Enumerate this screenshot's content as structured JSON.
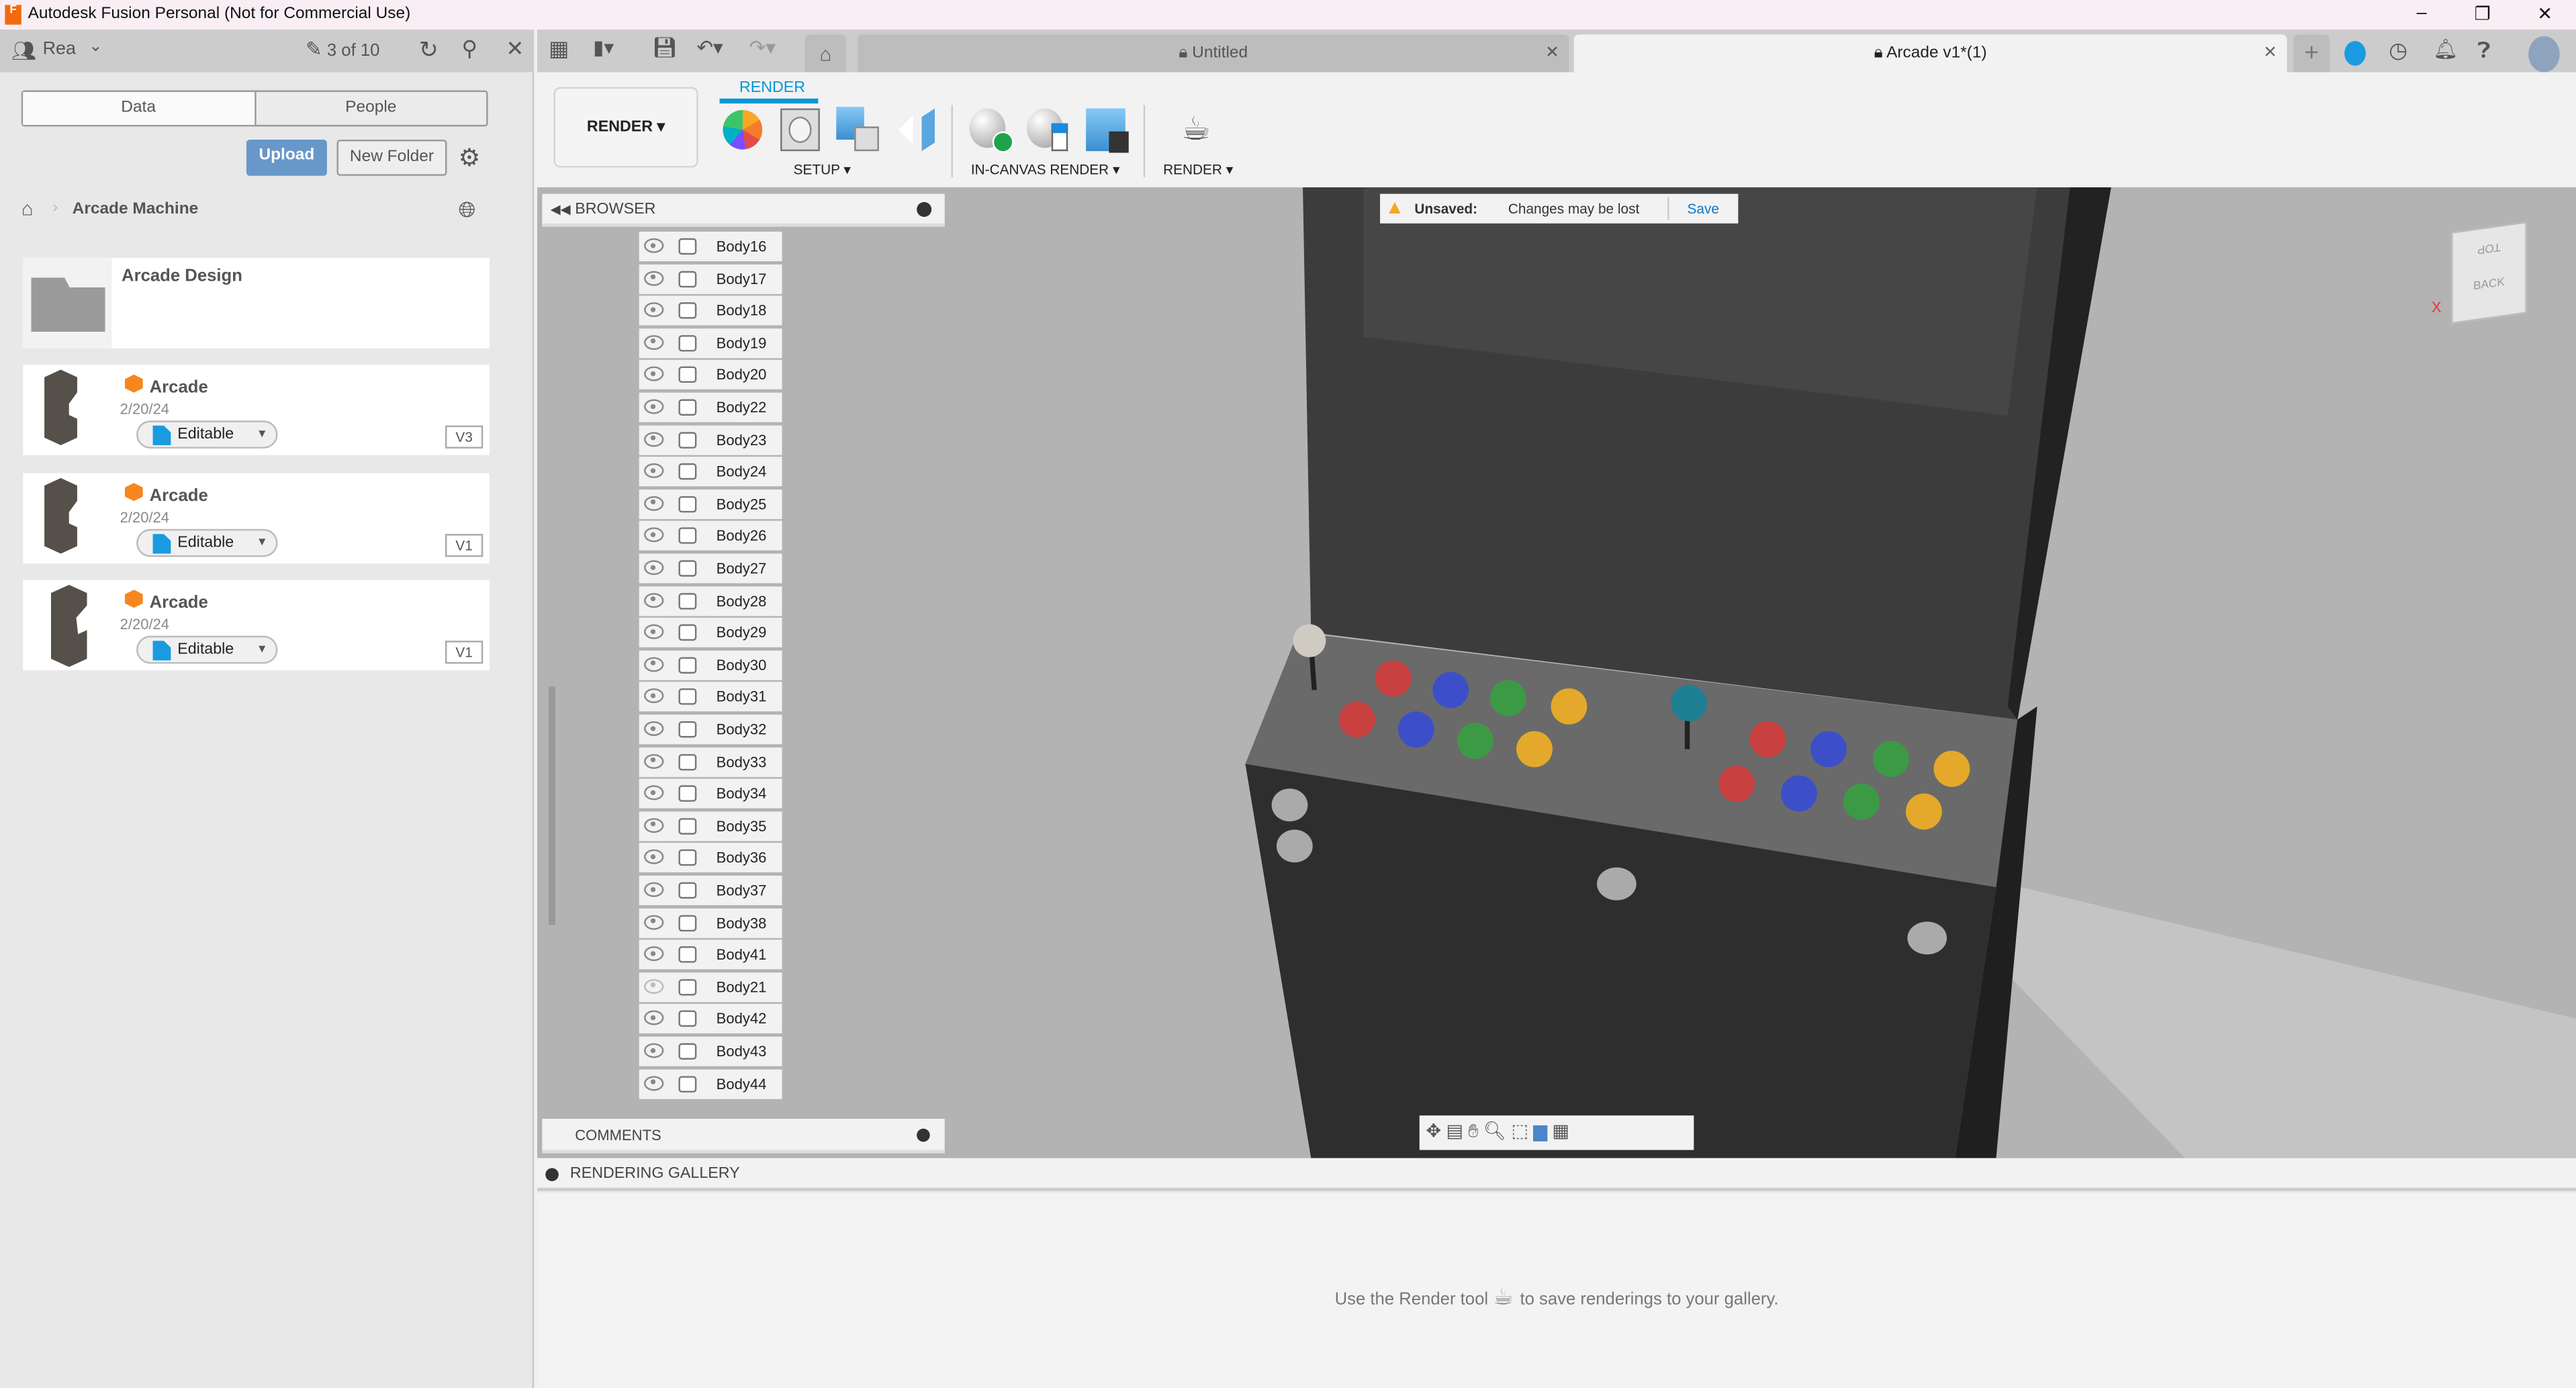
{
  "window": {
    "title": "Autodesk Fusion Personal (Not for Commercial Use)",
    "app_icon": "F"
  },
  "data_panel": {
    "team": "Rea",
    "job_count": "3 of 10",
    "tabs": [
      "Data",
      "People"
    ],
    "upload_label": "Upload",
    "new_folder_label": "New Folder",
    "breadcrumb": "Arcade Machine",
    "folder": {
      "name": "Arcade Design"
    },
    "files": [
      {
        "name": "Arcade",
        "date": "2/20/24",
        "status": "Editable",
        "version": "V3"
      },
      {
        "name": "Arcade",
        "date": "2/20/24",
        "status": "Editable",
        "version": "V1"
      },
      {
        "name": "Arcade",
        "date": "2/20/24",
        "status": "Editable",
        "version": "V1"
      }
    ]
  },
  "doc_tabs": [
    {
      "label": "Untitled",
      "active": false
    },
    {
      "label": "Arcade v1*(1)",
      "active": true
    }
  ],
  "toolbar": {
    "workspace": "RENDER",
    "active_tab": "RENDER",
    "groups": [
      "SETUP",
      "IN-CANVAS RENDER",
      "RENDER"
    ],
    "accent": "#0696d7"
  },
  "browser": {
    "title": "BROWSER",
    "items": [
      {
        "label": "Body16",
        "visible": true
      },
      {
        "label": "Body17",
        "visible": true
      },
      {
        "label": "Body18",
        "visible": true
      },
      {
        "label": "Body19",
        "visible": true
      },
      {
        "label": "Body20",
        "visible": true
      },
      {
        "label": "Body22",
        "visible": true
      },
      {
        "label": "Body23",
        "visible": true
      },
      {
        "label": "Body24",
        "visible": true
      },
      {
        "label": "Body25",
        "visible": true
      },
      {
        "label": "Body26",
        "visible": true
      },
      {
        "label": "Body27",
        "visible": true
      },
      {
        "label": "Body28",
        "visible": true
      },
      {
        "label": "Body29",
        "visible": true
      },
      {
        "label": "Body30",
        "visible": true
      },
      {
        "label": "Body31",
        "visible": true
      },
      {
        "label": "Body32",
        "visible": true
      },
      {
        "label": "Body33",
        "visible": true
      },
      {
        "label": "Body34",
        "visible": true
      },
      {
        "label": "Body35",
        "visible": true
      },
      {
        "label": "Body36",
        "visible": true
      },
      {
        "label": "Body37",
        "visible": true
      },
      {
        "label": "Body38",
        "visible": true
      },
      {
        "label": "Body41",
        "visible": true
      },
      {
        "label": "Body21",
        "visible": false
      },
      {
        "label": "Body42",
        "visible": true
      },
      {
        "label": "Body43",
        "visible": true
      },
      {
        "label": "Body44",
        "visible": true
      }
    ]
  },
  "banner": {
    "title": "Unsaved:",
    "message": "Changes may be lost",
    "action": "Save"
  },
  "viewcube": {
    "top": "TOP",
    "back": "BACK",
    "axis": "X"
  },
  "comments": {
    "title": "COMMENTS"
  },
  "gallery": {
    "title": "RENDERING GALLERY",
    "hint_before": "Use the Render tool",
    "hint_after": "to save renderings to your gallery."
  }
}
